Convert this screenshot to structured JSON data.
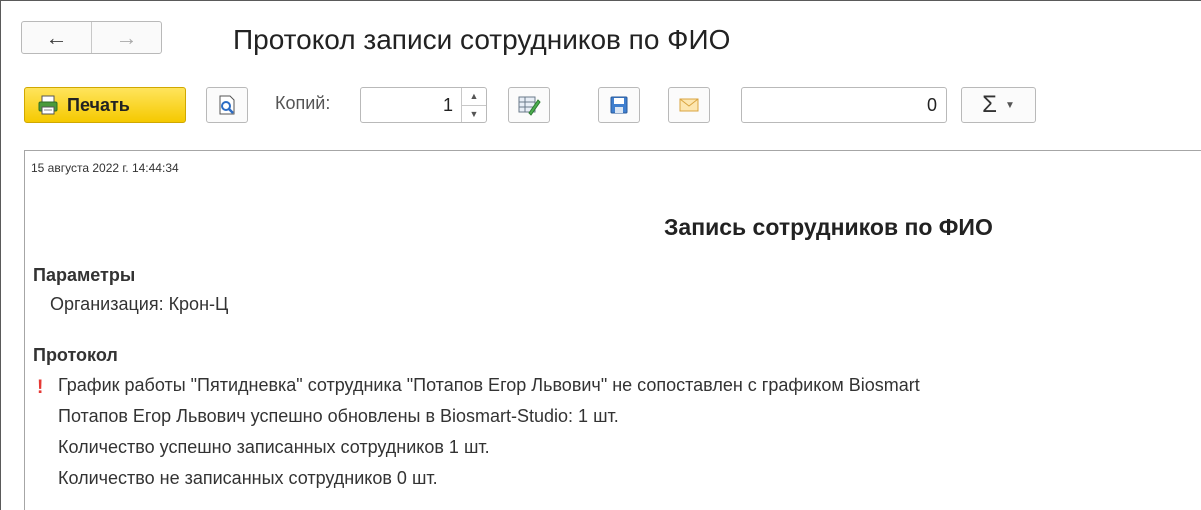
{
  "window": {
    "title": "Протокол записи сотрудников по ФИО",
    "nav": {
      "back_icon": "arrow-left-icon",
      "forward_icon": "arrow-right-icon"
    }
  },
  "toolbar": {
    "print_label": "Печать",
    "copies_label": "Копий:",
    "copies_value": "1",
    "sum_value": "0",
    "sum_symbol": "Σ",
    "icons": [
      "printer-icon",
      "preview-icon",
      "edit-icon",
      "save-icon",
      "email-icon",
      "sum-icon"
    ]
  },
  "document": {
    "timestamp": "15 августа 2022 г. 14:44:34",
    "title": "Запись сотрудников по ФИО",
    "params_heading": "Параметры",
    "organization_line": "Организация: Крон-Ц",
    "protocol_heading": "Протокол",
    "warning_mark": "!",
    "lines": [
      "График работы \"Пятидневка\" сотрудника \"Потапов Егор Львович\" не сопоставлен с графиком Biosmart",
      "Потапов Егор Львович успешно обновлены в Biosmart-Studio: 1 шт.",
      "Количество успешно записанных сотрудников 1 шт.",
      "Количество не записанных сотрудников 0 шт."
    ]
  },
  "colors": {
    "accent_yellow": "#f5c900",
    "warning_red": "#e53935"
  }
}
